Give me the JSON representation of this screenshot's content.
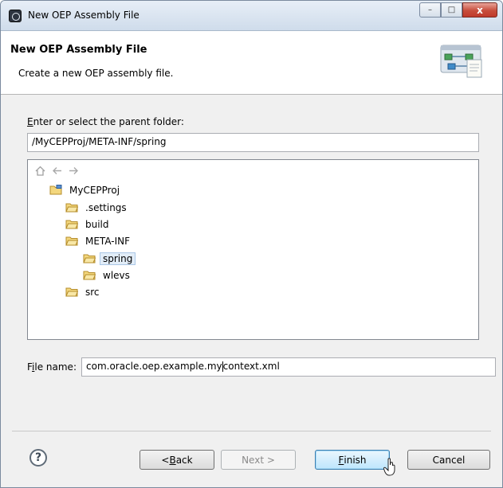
{
  "window": {
    "title": "New OEP Assembly File",
    "controls": {
      "minimize": "–",
      "maximize": "□",
      "close": "x"
    }
  },
  "header": {
    "title": "New OEP Assembly File",
    "description": "Create a new OEP assembly file."
  },
  "parent_folder": {
    "label": "Enter or select the parent folder:",
    "mnemonic": "E",
    "label_rest": "nter or select the parent folder:",
    "value": "/MyCEPProj/META-INF/spring"
  },
  "tree": {
    "toolbar": [
      "home-icon",
      "back-arrow-icon",
      "forward-arrow-icon"
    ],
    "items": [
      {
        "label": "MyCEPProj",
        "level": 0,
        "type": "project"
      },
      {
        "label": ".settings",
        "level": 1,
        "type": "folder"
      },
      {
        "label": "build",
        "level": 1,
        "type": "folder"
      },
      {
        "label": "META-INF",
        "level": 1,
        "type": "folder"
      },
      {
        "label": "spring",
        "level": 2,
        "type": "folder",
        "selected": true
      },
      {
        "label": "wlevs",
        "level": 2,
        "type": "folder"
      },
      {
        "label": "src",
        "level": 1,
        "type": "folder"
      }
    ]
  },
  "file_name": {
    "label": "File name:",
    "mnemonic": "i",
    "value_before_caret": "com.oracle.oep.example.my",
    "value_after_caret": "context.xml"
  },
  "buttons": {
    "back": {
      "pre": "< ",
      "mnemonic": "B",
      "rest": "ack"
    },
    "next": "Next >",
    "finish": {
      "mnemonic": "F",
      "rest": "inish"
    },
    "cancel": "Cancel",
    "help": "?"
  },
  "colors": {
    "accent": "#3c7fb1",
    "selection": "#e2edf8",
    "folder": "#e8c25a"
  }
}
